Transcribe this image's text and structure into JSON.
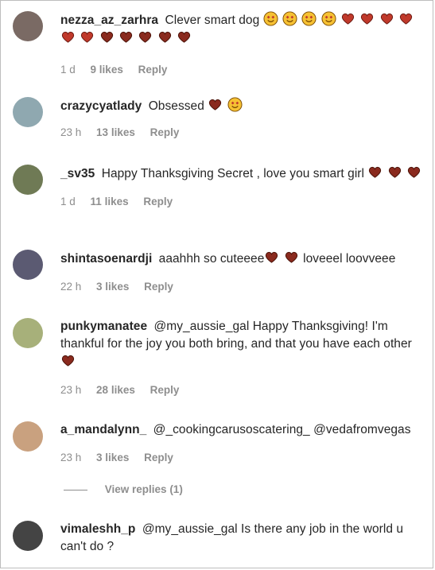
{
  "comments": [
    {
      "user": "nezza_az_zarhra",
      "text": "Clever smart dog",
      "emojis_after": [
        "grin-hearts",
        "grin-hearts",
        "grin-hearts",
        "grin-hearts",
        "heart",
        "heart",
        "heart",
        "heart",
        "heart",
        "heart",
        "heart",
        "heart",
        "heart",
        "heart"
      ],
      "time": "1 d",
      "likes": "9 likes",
      "reply": "Reply",
      "avatar_color": "#7a6a64"
    },
    {
      "user": "crazycyatlady",
      "text": "Obsessed",
      "emojis_after": [
        "heart",
        "grin-hearts"
      ],
      "time": "23 h",
      "likes": "13 likes",
      "reply": "Reply",
      "avatar_color": "#8fa8b0"
    },
    {
      "user": "_sv35",
      "text": "Happy Thanksgiving Secret , love you smart girl",
      "emojis_after": [
        "heart",
        "heart",
        "heart"
      ],
      "time": "1 d",
      "likes": "11 likes",
      "reply": "Reply",
      "avatar_color": "#6f7a55"
    },
    {
      "user": "shintasoenardji",
      "text": "aaahhh so cuteeee",
      "emojis_mid": [
        "heart",
        "heart"
      ],
      "text_after": "loveeel loovveee",
      "time": "22 h",
      "likes": "3 likes",
      "reply": "Reply",
      "avatar_color": "#5b5a72"
    },
    {
      "user": "punkymanatee",
      "mention": "@my_aussie_gal",
      "text": "Happy Thanksgiving! I'm thankful for the joy you both bring, and that you have each other",
      "emojis_after": [
        "heart"
      ],
      "time": "23 h",
      "likes": "28 likes",
      "reply": "Reply",
      "avatar_color": "#a7b07a"
    },
    {
      "user": "a_mandalynn_",
      "mention": "@_cookingcarusoscatering_",
      "text": "@vedafromvegas",
      "time": "23 h",
      "likes": "3 likes",
      "reply": "Reply",
      "avatar_color": "#c9a17f"
    },
    {
      "user": "vimaleshh_p",
      "mention": "@my_aussie_gal",
      "text": "Is there any job in the world u can't do ?",
      "avatar_color": "#444444"
    }
  ],
  "view_replies": "View replies (1)",
  "colors": {
    "heart": "#c0392b",
    "emoji": "#f6c133"
  }
}
